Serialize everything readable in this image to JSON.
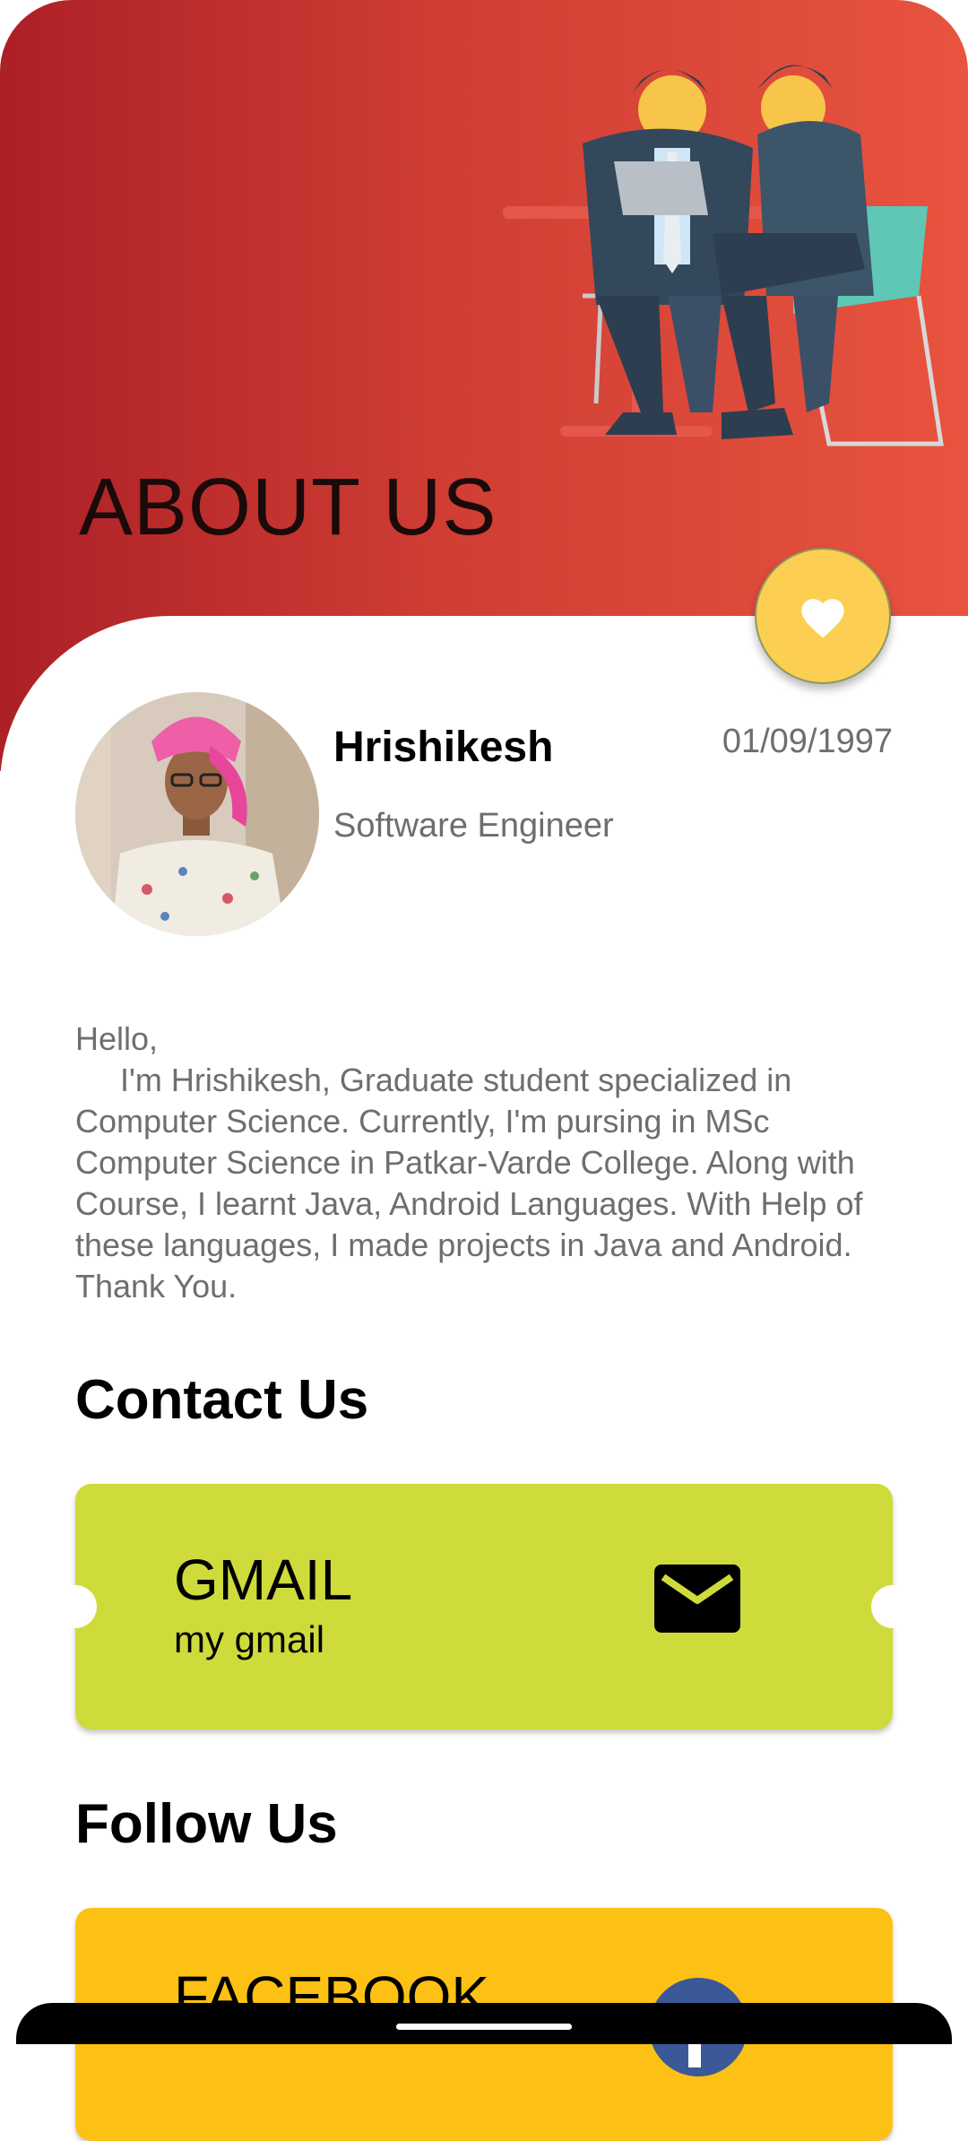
{
  "header": {
    "title": "ABOUT US"
  },
  "profile": {
    "name": "Hrishikesh",
    "role": "Software Engineer",
    "dob": "01/09/1997"
  },
  "bio": {
    "greeting": "Hello,",
    "text": "I'm Hrishikesh, Graduate student specialized in Computer Science. Currently, I'm pursing in MSc Computer Science in Patkar-Varde College. Along with Course, I learnt Java, Android Languages. With Help of these languages, I made projects in Java and Android. Thank You."
  },
  "contact": {
    "section_title": "Contact Us",
    "card_title": "GMAIL",
    "card_subtitle": "my gmail",
    "icon": "mail-icon"
  },
  "follow": {
    "section_title": "Follow Us",
    "card_title": "FACEBOOK",
    "icon": "facebook-icon"
  },
  "fab": {
    "icon": "heart-icon"
  },
  "colors": {
    "header_start": "#ac2026",
    "header_end": "#e8543f",
    "fab": "#fccf52",
    "gmail_card": "#cfdb3b",
    "facebook_card": "#fcc114",
    "facebook_blue": "#3b5998"
  }
}
